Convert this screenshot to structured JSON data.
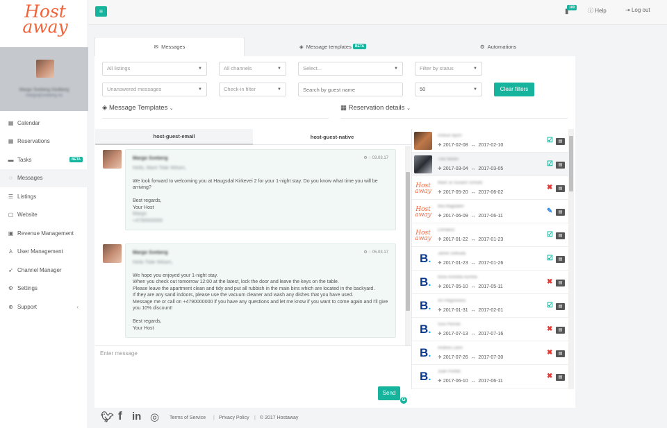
{
  "brand": {
    "line1": "Host",
    "line2": "away",
    "color": "#f0643c"
  },
  "accent_color": "#16b39d",
  "sidebar": {
    "profile": {
      "name": "Margo Sveberg Gedberg",
      "email": "margo@sveberg.no"
    },
    "items": [
      {
        "label": "Calendar",
        "icon": "calendar-icon",
        "glyph": "▦"
      },
      {
        "label": "Reservations",
        "icon": "calendar-check-icon",
        "glyph": "▦"
      },
      {
        "label": "Tasks",
        "icon": "tasks-icon",
        "glyph": "▬",
        "badge": "BETA"
      },
      {
        "label": "Messages",
        "icon": "comments-icon",
        "glyph": "◌"
      },
      {
        "label": "Listings",
        "icon": "list-icon",
        "glyph": "☰"
      },
      {
        "label": "Website",
        "icon": "window-icon",
        "glyph": "▢"
      },
      {
        "label": "Revenue Management",
        "icon": "money-icon",
        "glyph": "▣"
      },
      {
        "label": "User Management",
        "icon": "user-icon",
        "glyph": "♙"
      },
      {
        "label": "Channel Manager",
        "icon": "rocket-icon",
        "glyph": "➹"
      },
      {
        "label": "Settings",
        "icon": "cogs-icon",
        "glyph": "⚙"
      },
      {
        "label": "Support",
        "icon": "life-ring-icon",
        "glyph": "⊕",
        "chevron": "‹"
      }
    ]
  },
  "topbar": {
    "notifications": "100",
    "help": "Help",
    "logout": "Log out"
  },
  "tabs": [
    {
      "label": "Messages",
      "icon": "envelope-icon",
      "active": true
    },
    {
      "label": "Message templates",
      "icon": "cube-icon",
      "badge": "BETA"
    },
    {
      "label": "Automations",
      "icon": "gear-icon"
    }
  ],
  "filters": {
    "listings": "All listings",
    "channels": "All channels",
    "select": "Select...",
    "status": "Filter by status",
    "unanswered": "Unanswered messages",
    "checkin": "Check-in filter",
    "guest_search_placeholder": "Search by guest name",
    "per_page": "50",
    "clear": "Clear filters"
  },
  "sections": {
    "templates": "Message Templates",
    "reservation": "Reservation details"
  },
  "subtabs": [
    "host-guest-email",
    "host-guest-native"
  ],
  "messages": [
    {
      "sender": "Margo Sveberg",
      "date": "03.03.17",
      "lines": [
        "Hello, Marit Tilde Wilsen,",
        "",
        "We look forward to welcoming you at Haugsdal Kirkevei 2 for your 1-night stay. Do you know what time you will be arriving?",
        "",
        "Best regards,",
        "Your Host",
        "Margo",
        "+4790000000"
      ]
    },
    {
      "sender": "Margo Sveberg",
      "date": "05.03.17",
      "lines": [
        "Hello Tilde Wilsen,",
        "",
        "We hope you enjoyed your 1-night stay.",
        "When you check out tomorrow 12:00 at the latest, lock the door and leave the keys on the table.",
        "Please leave the apartment clean and tidy and put all rubbish in the main bins which are located in the backyard.",
        "If they are any sand indoors, please use the vacuum cleaner and wash any dishes that you have used.",
        "Message me or call on +4790000000 if you have any questions and let me know if you want to come again and I'll give you 10% discount!",
        "",
        "Best regards,",
        "Your Host"
      ]
    }
  ],
  "compose": {
    "placeholder": "Enter message",
    "send": "Send"
  },
  "reservations": [
    {
      "name": "Antoun Bjorn",
      "from": "2017-02-08",
      "to": "2017-02-10",
      "source": "photo",
      "status": "ok"
    },
    {
      "name": "Tine Nilsen",
      "from": "2017-03-04",
      "to": "2017-03-05",
      "source": "photo2",
      "status": "ok",
      "selected": true
    },
    {
      "name": "Marit Jo Susann Schultz",
      "from": "2017-05-20",
      "to": "2017-06-02",
      "source": "hostaway",
      "status": "cancelled"
    },
    {
      "name": "Mia Magdalen",
      "from": "2017-06-09",
      "to": "2017-06-11",
      "source": "hostaway",
      "status": "edit"
    },
    {
      "name": "Linnaeus",
      "from": "2017-01-22",
      "to": "2017-01-23",
      "source": "hostaway",
      "status": "ok"
    },
    {
      "name": "Janne Solhuda",
      "from": "2017-01-23",
      "to": "2017-01-26",
      "source": "booking",
      "status": "ok"
    },
    {
      "name": "Ilona Annelita Aurrela",
      "from": "2017-05-10",
      "to": "2017-05-11",
      "source": "booking",
      "status": "cancelled"
    },
    {
      "name": "Ari Pelgonness",
      "from": "2017-01-31",
      "to": "2017-02-01",
      "source": "booking",
      "status": "ok"
    },
    {
      "name": "Suvi Plonski",
      "from": "2017-07-13",
      "to": "2017-07-16",
      "source": "booking",
      "status": "cancelled"
    },
    {
      "name": "Andrea Lanni",
      "from": "2017-07-26",
      "to": "2017-07-30",
      "source": "booking",
      "status": "cancelled"
    },
    {
      "name": "Juan Portillo",
      "from": "2017-06-10",
      "to": "2017-06-11",
      "source": "booking",
      "status": "cancelled"
    }
  ],
  "footer": {
    "terms": "Terms of Service",
    "privacy": "Privacy Policy",
    "copyright": "© 2017 Hostaway"
  }
}
